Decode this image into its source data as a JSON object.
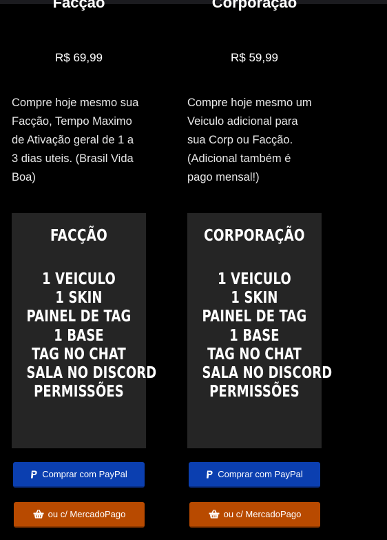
{
  "cards": [
    {
      "title": "Facção",
      "price": "R$ 69,99",
      "description_lines": [
        "Compre hoje mesmo sua",
        "Facção, Tempo Maximo",
        "de Ativação geral de 1 a",
        "3 dias uteis. (Brasil Vida",
        "Boa)"
      ],
      "poster_title": "FACÇÃO",
      "poster_items": [
        "1 VEICULO",
        "1 SKIN",
        "PAINEL DE TAG",
        "1 BASE",
        "TAG NO CHAT",
        "SALA NO DISCORD",
        "PERMISSÕES"
      ],
      "paypal_label": "Comprar com PayPal",
      "mercadopago_label": "ou c/ MercadoPago"
    },
    {
      "title": "Corporação",
      "price": "R$ 59,99",
      "description_lines": [
        "Compre hoje mesmo um",
        "Veiculo adicional para",
        "sua Corp ou Facção.",
        "(Adicional também é",
        "pago mensal!)"
      ],
      "poster_title": "CORPORAÇÃO",
      "poster_items": [
        "1 VEICULO",
        "1 SKIN",
        "PAINEL DE TAG",
        "1 BASE",
        "TAG NO CHAT",
        "SALA NO DISCORD",
        "PERMISSÕES"
      ],
      "paypal_label": "Comprar com PayPal",
      "mercadopago_label": "ou c/ MercadoPago"
    }
  ],
  "icons": {
    "paypal": "paypal-icon",
    "mercadopago": "basket-icon"
  },
  "colors": {
    "background": "#000000",
    "poster": "#252525",
    "paypal_button": "#0b3fb0",
    "mercadopago_button": "#b84a00"
  }
}
